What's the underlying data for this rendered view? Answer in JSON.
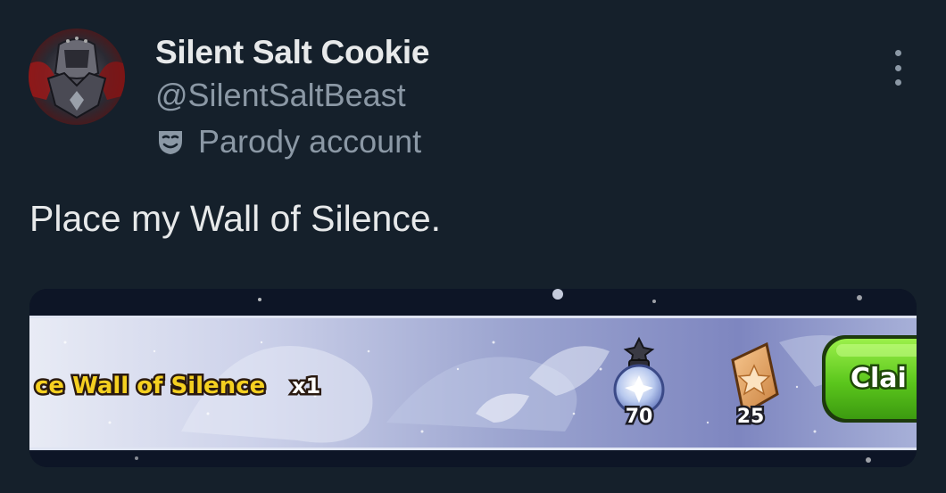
{
  "author": {
    "display_name": "Silent Salt Cookie",
    "handle": "@SilentSaltBeast",
    "label": "Parody account"
  },
  "icons": {
    "label_icon": "theater-mask-icon",
    "menu_icon": "more-vertical-icon"
  },
  "tweet": {
    "text": "Place my Wall of Silence."
  },
  "media": {
    "reward_text": "ce Wall of Silence",
    "reward_quantity": "x1",
    "items": [
      {
        "icon": "crystal-orb-icon",
        "count": "70"
      },
      {
        "icon": "star-shard-icon",
        "count": "25"
      }
    ],
    "button_label": "Clai"
  },
  "colors": {
    "background": "#15202b",
    "primary_text": "#e7e9ea",
    "secondary_text": "#8b98a5",
    "reward_text": "#f5d020",
    "button_green": "#62cc1f"
  }
}
